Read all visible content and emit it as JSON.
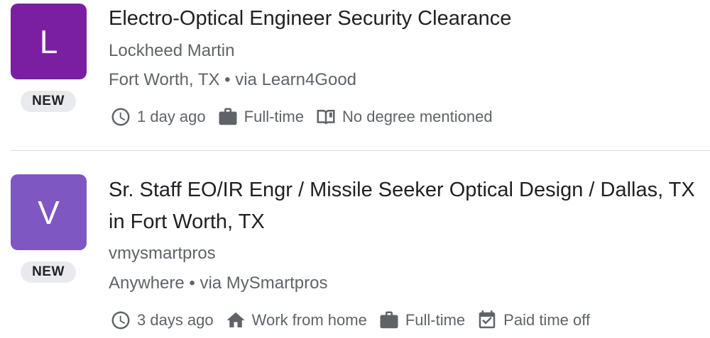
{
  "jobs": [
    {
      "logo_letter": "L",
      "logo_color": "#7b1fa2",
      "badge": "NEW",
      "title": "Electro-Optical Engineer Security Clearance",
      "company": "Lockheed Martin",
      "location": "Fort Worth, TX • via Learn4Good",
      "meta": [
        {
          "icon": "clock-icon",
          "text": "1 day ago"
        },
        {
          "icon": "briefcase-icon",
          "text": "Full-time"
        },
        {
          "icon": "book-icon",
          "text": "No degree mentioned"
        }
      ]
    },
    {
      "logo_letter": "V",
      "logo_color": "#7e57c2",
      "badge": "NEW",
      "title": "Sr. Staff EO/IR Engr / Missile Seeker Optical Design / Dallas, TX in Fort Worth, TX",
      "company": "vmysmartpros",
      "location": "Anywhere • via MySmartpros",
      "meta": [
        {
          "icon": "clock-icon",
          "text": "3 days ago"
        },
        {
          "icon": "home-icon",
          "text": "Work from home"
        },
        {
          "icon": "briefcase-icon",
          "text": "Full-time"
        },
        {
          "icon": "calendar-check-icon",
          "text": "Paid time off"
        }
      ]
    }
  ]
}
